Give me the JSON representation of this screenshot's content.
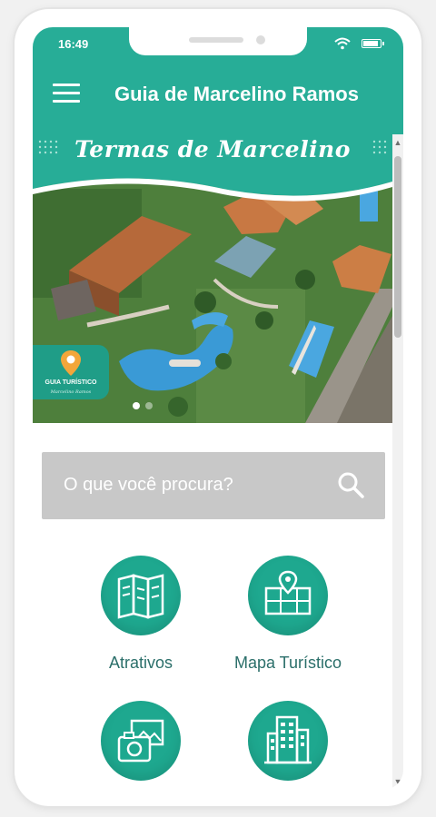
{
  "status_bar": {
    "time": "16:49"
  },
  "header": {
    "title": "Guia de Marcelino Ramos",
    "menu_icon": "hamburger-icon"
  },
  "banner": {
    "title": "Termas de Marcelino",
    "badge_title": "GUIA TURÍSTICO",
    "badge_subtitle": "Marcelino Ramos",
    "active_slide": 1,
    "slide_count": 2
  },
  "search": {
    "placeholder": "O que você procura?",
    "icon": "search-icon"
  },
  "menu": {
    "items": [
      {
        "label": "Atrativos",
        "icon": "map-brochure-icon"
      },
      {
        "label": "Mapa Turístico",
        "icon": "map-location-icon"
      },
      {
        "label": "",
        "icon": "photo-camera-icon"
      },
      {
        "label": "",
        "icon": "buildings-icon"
      }
    ]
  },
  "colors": {
    "accent": "#27ad97",
    "tile": "#1ea88f",
    "label": "#2b6f6a",
    "search_bg": "#c8c8c8"
  }
}
